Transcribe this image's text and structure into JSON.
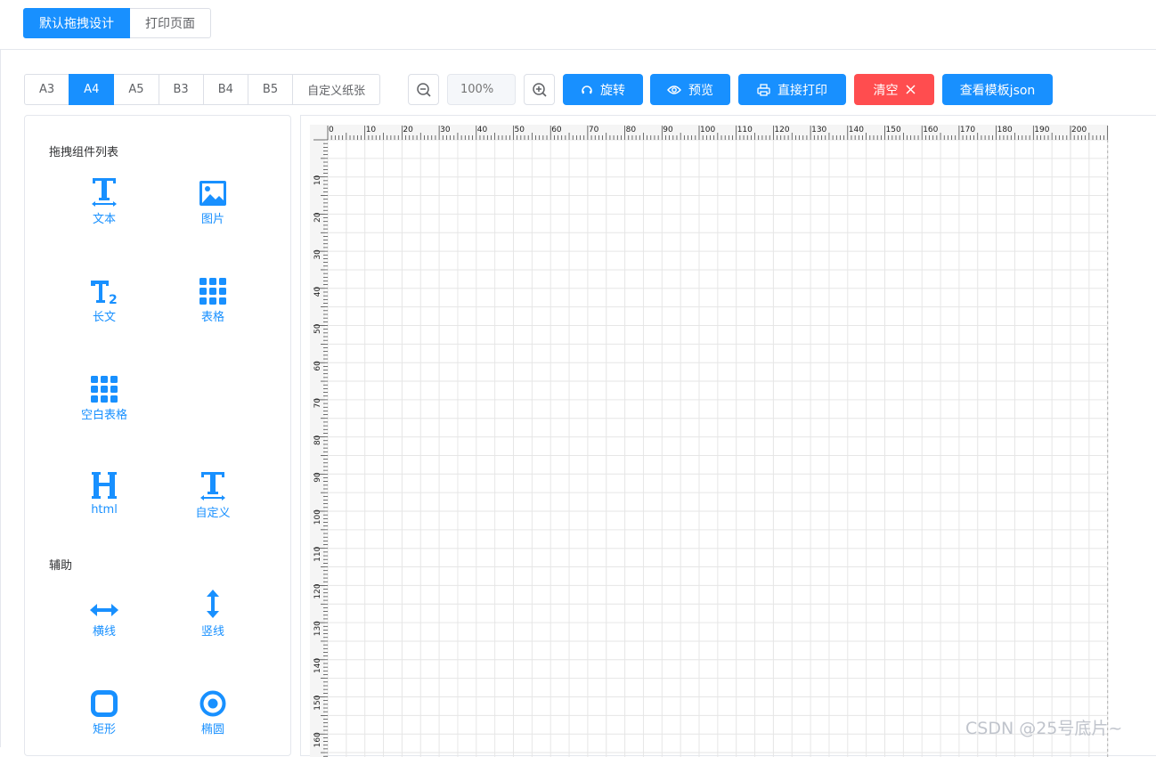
{
  "tabs": [
    {
      "label": "默认拖拽设计",
      "active": true
    },
    {
      "label": "打印页面",
      "active": false
    }
  ],
  "toolbar": {
    "paper_sizes": [
      {
        "label": "A3",
        "active": false
      },
      {
        "label": "A4",
        "active": true
      },
      {
        "label": "A5",
        "active": false
      },
      {
        "label": "B3",
        "active": false
      },
      {
        "label": "B4",
        "active": false
      },
      {
        "label": "B5",
        "active": false
      },
      {
        "label": "自定义纸张",
        "active": false
      }
    ],
    "zoom_out_icon": "zoom-out-icon",
    "zoom_in_icon": "zoom-in-icon",
    "zoom_placeholder": "100%",
    "rotate_label": "旋转",
    "preview_label": "预览",
    "print_label": "直接打印",
    "clear_label": "清空",
    "json_label": "查看模板json"
  },
  "sidebar": {
    "components_title": "拖拽组件列表",
    "components": [
      {
        "label": "文本",
        "icon": "text-icon"
      },
      {
        "label": "图片",
        "icon": "image-icon"
      },
      {
        "label": "长文",
        "icon": "long-text-icon"
      },
      {
        "label": "表格",
        "icon": "table-icon"
      },
      {
        "label": "空白表格",
        "icon": "blank-table-icon"
      },
      {
        "label": "html",
        "icon": "html-icon"
      },
      {
        "label": "自定义",
        "icon": "custom-icon"
      }
    ],
    "aux_title": "辅助",
    "aux": [
      {
        "label": "横线",
        "icon": "horizontal-line-icon"
      },
      {
        "label": "竖线",
        "icon": "vertical-line-icon"
      },
      {
        "label": "矩形",
        "icon": "rect-icon"
      },
      {
        "label": "椭圆",
        "icon": "ellipse-icon"
      }
    ]
  },
  "canvas": {
    "ruler_top": [
      "0",
      "10",
      "20",
      "30",
      "40",
      "50",
      "60",
      "70",
      "80",
      "90",
      "100",
      "110",
      "120",
      "130",
      "140",
      "150",
      "160",
      "170",
      "180",
      "190",
      "200"
    ],
    "ruler_left": [
      "10",
      "20",
      "30",
      "40",
      "50",
      "60",
      "70",
      "80",
      "90",
      "100",
      "110",
      "120",
      "130",
      "140",
      "150",
      "160"
    ]
  },
  "watermark": "CSDN @25号底片~",
  "colors": {
    "primary": "#1890ff",
    "danger": "#ff4d4f"
  }
}
